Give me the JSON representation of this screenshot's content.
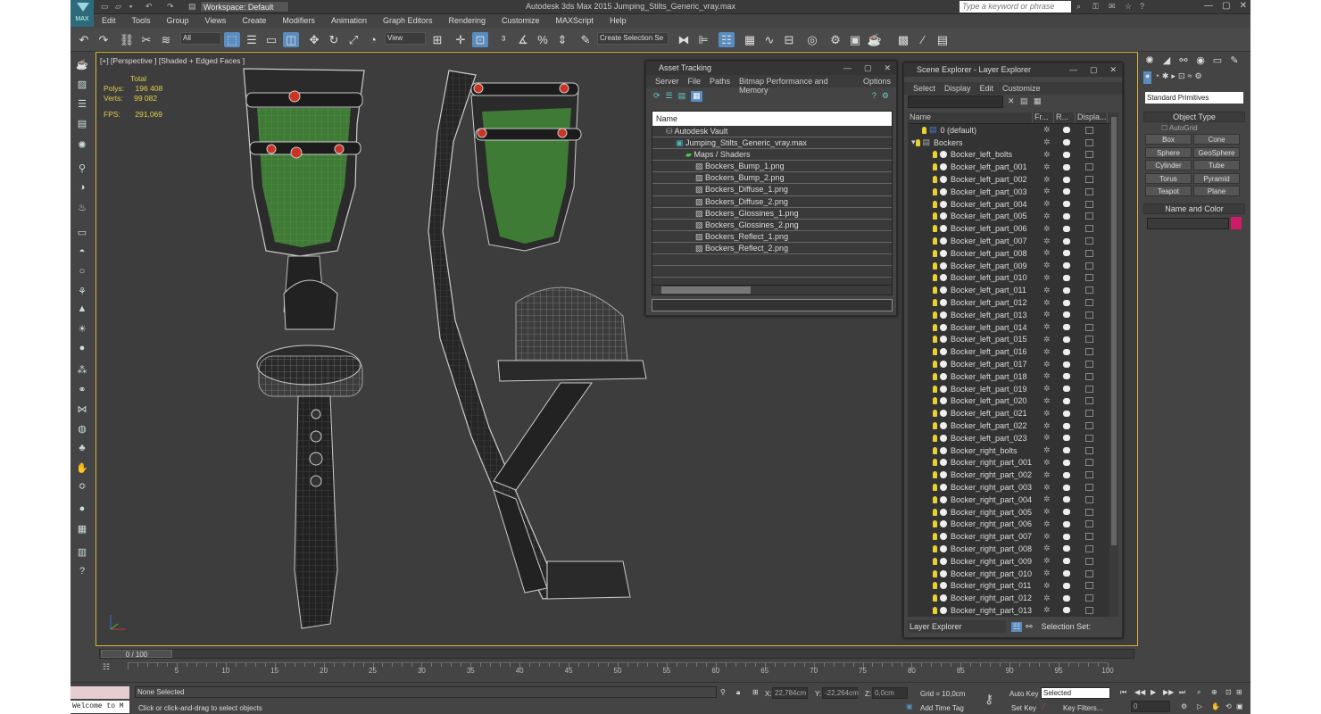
{
  "titlebar": {
    "workspace": "Workspace: Default",
    "title": "Autodesk 3ds Max  2015    Jumping_Stilts_Generic_vray.max",
    "search_placeholder": "Type a keyword or phrase",
    "logo_label": "MAX"
  },
  "menu": [
    "Edit",
    "Tools",
    "Group",
    "Views",
    "Create",
    "Modifiers",
    "Animation",
    "Graph Editors",
    "Rendering",
    "Customize",
    "MAXScript",
    "Help"
  ],
  "toolbar": {
    "filter": "All",
    "ref_coord": "View",
    "selection_set": "Create Selection Se"
  },
  "viewport": {
    "label": "[+] [Perspective ] [Shaded + Edged Faces ]",
    "stats_header": "Total",
    "polys_label": "Polys:",
    "polys": "196 408",
    "verts_label": "Verts:",
    "verts": "99 082",
    "fps_label": "FPS:",
    "fps": "291,069"
  },
  "asset_tracking": {
    "title": "Asset Tracking",
    "menu": [
      "Server",
      "File",
      "Paths",
      "Bitmap Performance and Memory",
      "Options"
    ],
    "column": "Name",
    "rows": [
      {
        "level": 1,
        "text": "Autodesk Vault",
        "icon": "vault"
      },
      {
        "level": 2,
        "text": "Jumping_Stilts_Generic_vray.max",
        "icon": "max-file"
      },
      {
        "level": 3,
        "text": "Maps / Shaders",
        "icon": "maps"
      },
      {
        "level": 4,
        "text": "Bockers_Bump_1.png",
        "icon": "image"
      },
      {
        "level": 4,
        "text": "Bockers_Bump_2.png",
        "icon": "image"
      },
      {
        "level": 4,
        "text": "Bockers_Diffuse_1.png",
        "icon": "image"
      },
      {
        "level": 4,
        "text": "Bockers_Diffuse_2.png",
        "icon": "image"
      },
      {
        "level": 4,
        "text": "Bockers_Glossines_1.png",
        "icon": "image"
      },
      {
        "level": 4,
        "text": "Bockers_Glossines_2.png",
        "icon": "image"
      },
      {
        "level": 4,
        "text": "Bockers_Reflect_1.png",
        "icon": "image"
      },
      {
        "level": 4,
        "text": "Bockers_Reflect_2.png",
        "icon": "image"
      }
    ]
  },
  "scene_explorer": {
    "title": "Scene Explorer - Layer Explorer",
    "menu": [
      "Select",
      "Display",
      "Edit",
      "Customize"
    ],
    "columns": [
      "Name",
      "Fr...",
      "R...",
      "Displa..."
    ],
    "layers": [
      "0 (default)",
      "Bockers"
    ],
    "objects": [
      "Bocker_left_bolts",
      "Bocker_left_part_001",
      "Bocker_left_part_002",
      "Bocker_left_part_003",
      "Bocker_left_part_004",
      "Bocker_left_part_005",
      "Bocker_left_part_006",
      "Bocker_left_part_007",
      "Bocker_left_part_008",
      "Bocker_left_part_009",
      "Bocker_left_part_010",
      "Bocker_left_part_011",
      "Bocker_left_part_012",
      "Bocker_left_part_013",
      "Bocker_left_part_014",
      "Bocker_left_part_015",
      "Bocker_left_part_016",
      "Bocker_left_part_017",
      "Bocker_left_part_018",
      "Bocker_left_part_019",
      "Bocker_left_part_020",
      "Bocker_left_part_021",
      "Bocker_left_part_022",
      "Bocker_left_part_023",
      "Bocker_right_bolts",
      "Bocker_right_part_001",
      "Bocker_right_part_002",
      "Bocker_right_part_003",
      "Bocker_right_part_004",
      "Bocker_right_part_005",
      "Bocker_right_part_006",
      "Bocker_right_part_007",
      "Bocker_right_part_008",
      "Bocker_right_part_009",
      "Bocker_right_part_010",
      "Bocker_right_part_011",
      "Bocker_right_part_012",
      "Bocker_right_part_013"
    ],
    "footer_explorer": "Layer Explorer",
    "footer_sets": "Selection Set:"
  },
  "command_panel": {
    "primitive_type": "Standard Primitives",
    "object_type_header": "Object Type",
    "autogrid": "AutoGrid",
    "buttons": [
      "Box",
      "Cone",
      "Sphere",
      "GeoSphere",
      "Cylinder",
      "Tube",
      "Torus",
      "Pyramid",
      "Teapot",
      "Plane"
    ],
    "name_color_header": "Name and Color",
    "color": "#d01a6a"
  },
  "timeline": {
    "frame": "0 / 100",
    "ticks": [
      "5",
      "10",
      "15",
      "20",
      "25",
      "30",
      "35",
      "40",
      "45",
      "50",
      "55",
      "60",
      "65",
      "70",
      "75",
      "80",
      "85",
      "90",
      "95",
      "100"
    ]
  },
  "status": {
    "welcome": "Welcome to M",
    "selection": "None Selected",
    "prompt": "Click or click-and-drag to select objects",
    "x_label": "X:",
    "x": "22,784cm",
    "y_label": "Y:",
    "y": "-22,264cm",
    "z_label": "Z:",
    "z": "0,0cm",
    "grid": "Grid = 10,0cm",
    "add_time_tag": "Add Time Tag",
    "auto_key": "Auto Key",
    "set_key": "Set Key",
    "key_mode": "Selected",
    "key_filters": "Key Filters...",
    "frame_field": "0"
  }
}
